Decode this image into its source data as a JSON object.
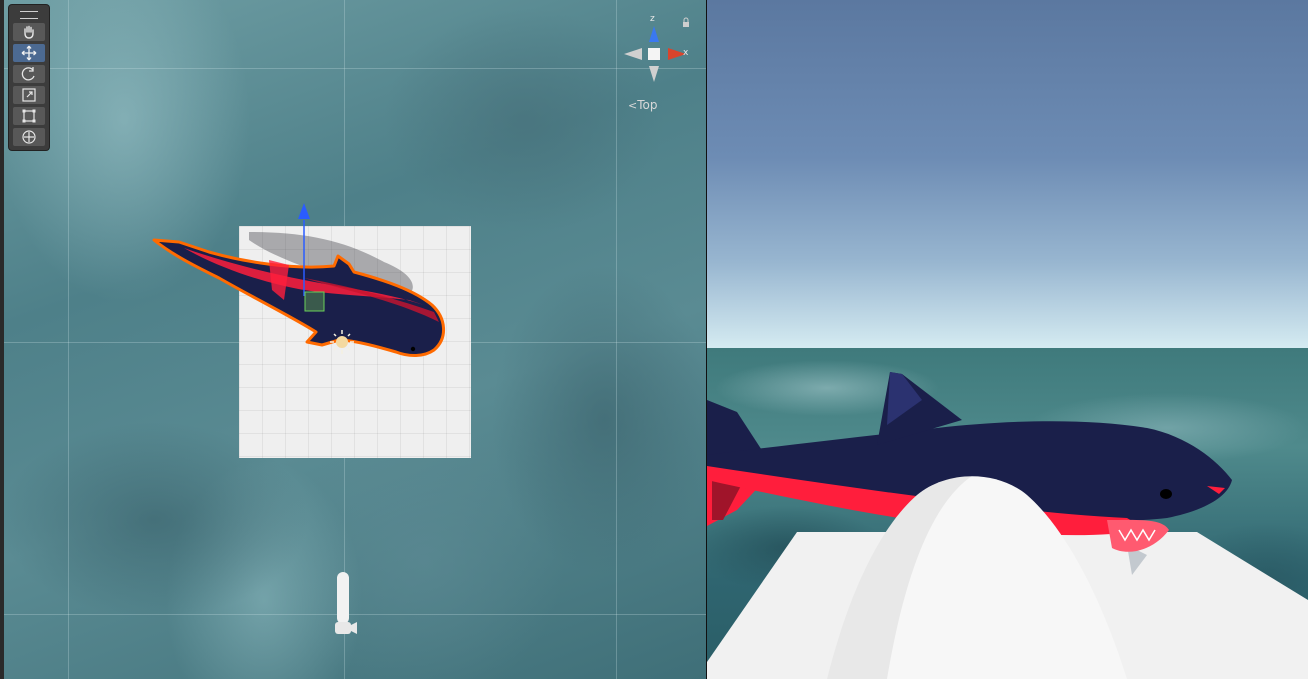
{
  "scene_view": {
    "tools": [
      {
        "name": "hand-tool",
        "icon": "hand-icon",
        "active": false
      },
      {
        "name": "move-tool",
        "icon": "move-arrows-icon",
        "active": true
      },
      {
        "name": "rotate-tool",
        "icon": "rotate-icon",
        "active": false
      },
      {
        "name": "scale-tool",
        "icon": "scale-icon",
        "active": false
      },
      {
        "name": "rect-tool",
        "icon": "rect-transform-icon",
        "active": false
      },
      {
        "name": "transform-tool",
        "icon": "transform-icon",
        "active": false
      }
    ],
    "gizmo": {
      "z_label": "z",
      "x_label": "x",
      "view_label": "Top"
    },
    "colors": {
      "selection_outline": "#ff6a00",
      "shark_body": "#1a1f4a",
      "shark_belly": "#ff1e3c",
      "move_handle_blue": "#2a5cff",
      "axis_red": "#d9442c"
    }
  },
  "game_view": {
    "colors": {
      "sky_top": "#5b78a0",
      "horizon": "#d6ecf2",
      "sea": "#3f7a7c"
    }
  }
}
